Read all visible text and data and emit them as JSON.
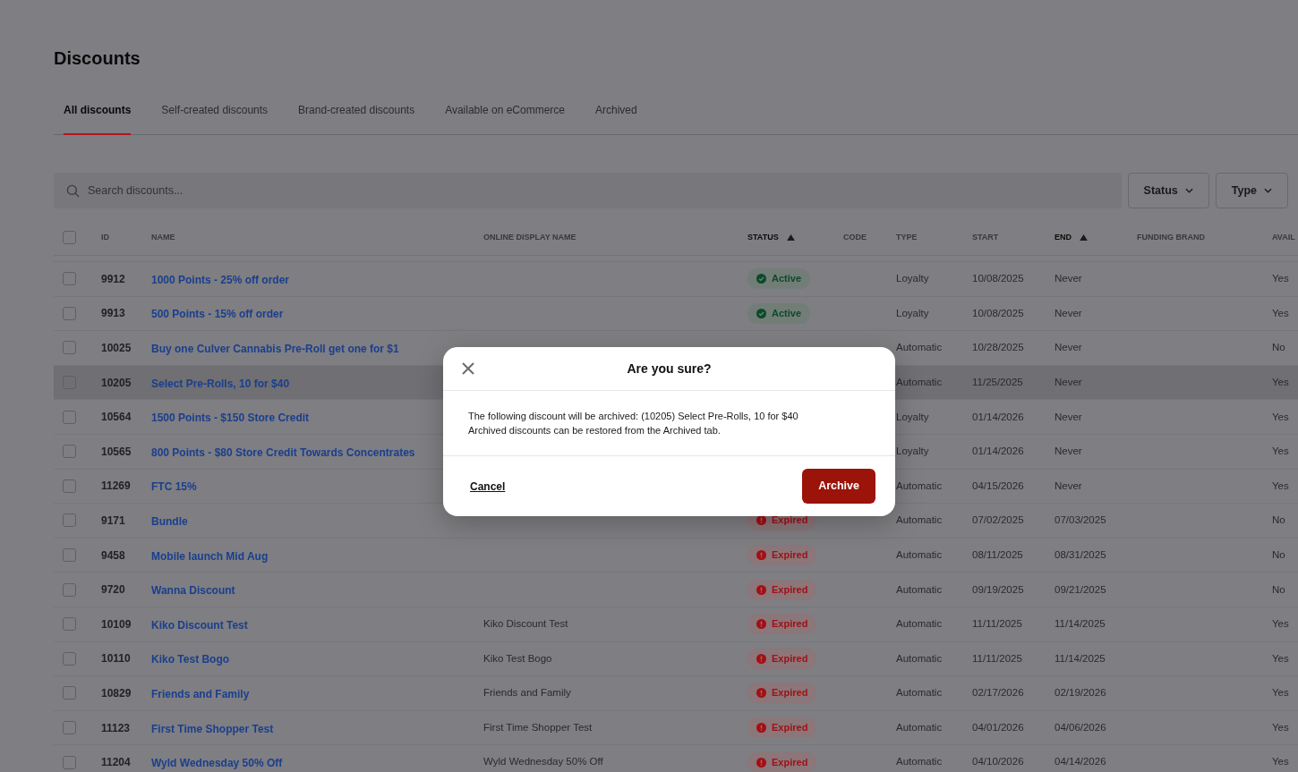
{
  "page": {
    "title": "Discounts"
  },
  "tabs": [
    {
      "label": "All discounts",
      "selected": true
    },
    {
      "label": "Self-created discounts",
      "selected": false
    },
    {
      "label": "Brand-created discounts",
      "selected": false
    },
    {
      "label": "Available on eCommerce",
      "selected": false
    },
    {
      "label": "Archived",
      "selected": false
    }
  ],
  "search": {
    "placeholder": "Search discounts..."
  },
  "filters": [
    {
      "label": "Status"
    },
    {
      "label": "Type"
    }
  ],
  "table": {
    "select_all": {
      "checked": false
    },
    "columns": [
      {
        "label": "ID",
        "sorted": false
      },
      {
        "label": "NAME",
        "sorted": false
      },
      {
        "label": "ONLINE DISPLAY NAME",
        "sorted": false
      },
      {
        "label": "STATUS",
        "sorted": true
      },
      {
        "label": "CODE",
        "sorted": false
      },
      {
        "label": "TYPE",
        "sorted": false
      },
      {
        "label": "START",
        "sorted": false
      },
      {
        "label": "END",
        "sorted": true
      },
      {
        "label": "FUNDING BRAND",
        "sorted": false
      },
      {
        "label": "AVAIL",
        "sorted": false
      }
    ],
    "rows": [
      {
        "checked": false,
        "highlighted": false,
        "id": "9912",
        "name": "1000 Points - 25% off order",
        "status": {
          "kind": "active",
          "label": "Active"
        },
        "type": "Loyalty",
        "start": "10/08/2025",
        "end": "Never",
        "available": "Yes"
      },
      {
        "checked": false,
        "highlighted": false,
        "id": "9913",
        "name": "500 Points - 15% off order",
        "status": {
          "kind": "active",
          "label": "Active"
        },
        "type": "Loyalty",
        "start": "10/08/2025",
        "end": "Never",
        "available": "Yes"
      },
      {
        "checked": false,
        "highlighted": false,
        "id": "10025",
        "name": "Buy one Culver Cannabis Pre-Roll get one for $1",
        "type": "Automatic",
        "start": "10/28/2025",
        "end": "Never",
        "available": "No"
      },
      {
        "checked": false,
        "highlighted": true,
        "id": "10205",
        "name": "Select Pre-Rolls, 10 for $40",
        "type": "Automatic",
        "start": "11/25/2025",
        "end": "Never",
        "available": "Yes"
      },
      {
        "checked": false,
        "highlighted": false,
        "id": "10564",
        "name": "1500 Points - $150 Store Credit",
        "type": "Loyalty",
        "start": "01/14/2026",
        "end": "Never",
        "available": "Yes"
      },
      {
        "checked": false,
        "highlighted": false,
        "id": "10565",
        "name": "800 Points - $80 Store Credit Towards Concentrates",
        "type": "Loyalty",
        "start": "01/14/2026",
        "end": "Never",
        "available": "Yes"
      },
      {
        "checked": false,
        "highlighted": false,
        "id": "11269",
        "name": "FTC 15%",
        "type": "Automatic",
        "start": "04/15/2026",
        "end": "Never",
        "available": "Yes"
      },
      {
        "checked": false,
        "highlighted": false,
        "id": "9171",
        "name": "Bundle",
        "status": {
          "kind": "expired",
          "label": "Expired"
        },
        "type": "Automatic",
        "start": "07/02/2025",
        "end": "07/03/2025",
        "available": "No"
      },
      {
        "checked": false,
        "highlighted": false,
        "id": "9458",
        "name": "Mobile launch Mid Aug",
        "status": {
          "kind": "expired",
          "label": "Expired"
        },
        "type": "Automatic",
        "start": "08/11/2025",
        "end": "08/31/2025",
        "available": "No"
      },
      {
        "checked": false,
        "highlighted": false,
        "id": "9720",
        "name": "Wanna Discount",
        "status": {
          "kind": "expired",
          "label": "Expired"
        },
        "type": "Automatic",
        "start": "09/19/2025",
        "end": "09/21/2025",
        "available": "No"
      },
      {
        "checked": false,
        "highlighted": false,
        "id": "10109",
        "name": "Kiko Discount Test",
        "online_display_name": "Kiko Discount Test",
        "status": {
          "kind": "expired",
          "label": "Expired"
        },
        "type": "Automatic",
        "start": "11/11/2025",
        "end": "11/14/2025",
        "available": "Yes"
      },
      {
        "checked": false,
        "highlighted": false,
        "id": "10110",
        "name": "Kiko Test Bogo",
        "online_display_name": "Kiko Test Bogo",
        "status": {
          "kind": "expired",
          "label": "Expired"
        },
        "type": "Automatic",
        "start": "11/11/2025",
        "end": "11/14/2025",
        "available": "Yes"
      },
      {
        "checked": false,
        "highlighted": false,
        "id": "10829",
        "name": "Friends and Family",
        "online_display_name": "Friends and Family",
        "status": {
          "kind": "expired",
          "label": "Expired"
        },
        "type": "Automatic",
        "start": "02/17/2026",
        "end": "02/19/2026",
        "available": "Yes"
      },
      {
        "checked": false,
        "highlighted": false,
        "id": "11123",
        "name": "First Time Shopper Test",
        "online_display_name": "First Time Shopper Test",
        "status": {
          "kind": "expired",
          "label": "Expired"
        },
        "type": "Automatic",
        "start": "04/01/2026",
        "end": "04/06/2026",
        "available": "Yes"
      },
      {
        "checked": false,
        "highlighted": false,
        "id": "11204",
        "name": "Wyld Wednesday 50% Off",
        "online_display_name": "Wyld Wednesday 50% Off",
        "status": {
          "kind": "expired",
          "label": "Expired"
        },
        "type": "Automatic",
        "start": "04/10/2026",
        "end": "04/14/2026",
        "available": "Yes"
      }
    ]
  },
  "dialog": {
    "title": "Are you sure?",
    "message": [
      "The following discount will be archived: (10205) Select Pre-Rolls, 10 for $40",
      "Archived discounts can be restored from the Archived tab."
    ],
    "cancel": "Cancel",
    "confirm": "Archive"
  }
}
